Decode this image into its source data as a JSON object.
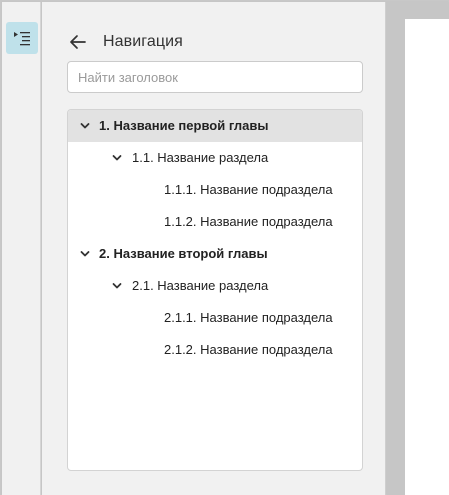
{
  "panel": {
    "title": "Навигация",
    "search_placeholder": "Найти заголовок"
  },
  "icons": {
    "toggle": "navigation-list-icon",
    "back": "arrow-left-icon",
    "expand": "chevron-down-icon"
  },
  "colors": {
    "toggle_active_bg": "#bfe1ea",
    "selected_row_bg": "#e2e2e2"
  },
  "tree": {
    "items": [
      {
        "label": "1. Название первой главы",
        "level": 1,
        "expanded": true,
        "selected": true,
        "bold": true
      },
      {
        "label": "1.1. Название раздела",
        "level": 2,
        "expanded": true,
        "selected": false,
        "bold": false
      },
      {
        "label": "1.1.1. Название подраздела",
        "level": 3,
        "selected": false,
        "bold": false
      },
      {
        "label": "1.1.2. Название подраздела",
        "level": 3,
        "selected": false,
        "bold": false
      },
      {
        "label": "2. Название второй главы",
        "level": 1,
        "expanded": true,
        "selected": false,
        "bold": true
      },
      {
        "label": "2.1. Название раздела",
        "level": 2,
        "expanded": true,
        "selected": false,
        "bold": false
      },
      {
        "label": "2.1.1. Название подраздела",
        "level": 3,
        "selected": false,
        "bold": false
      },
      {
        "label": "2.1.2. Название подраздела",
        "level": 3,
        "selected": false,
        "bold": false
      }
    ]
  }
}
